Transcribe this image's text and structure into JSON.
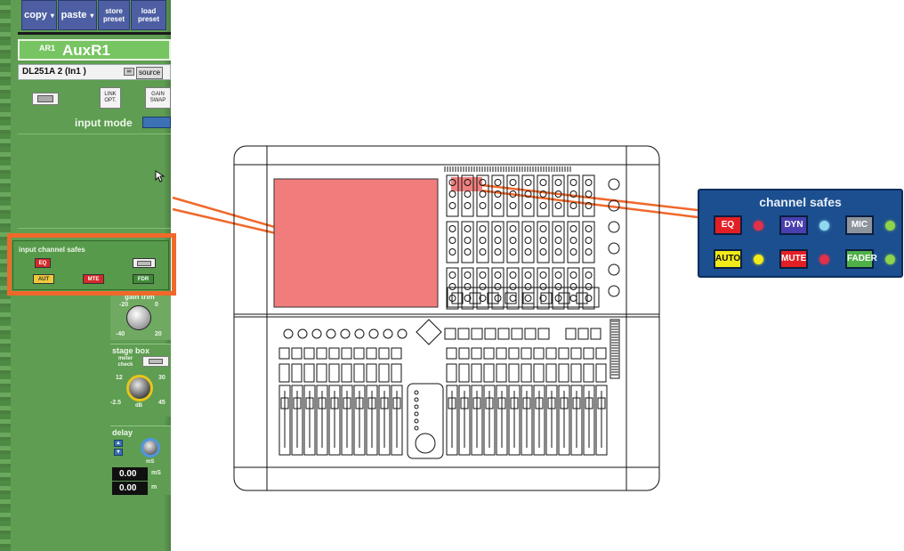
{
  "toolbar": {
    "copy_label": "copy",
    "paste_label": "paste",
    "store_preset_label": "store preset",
    "load_preset_label": "load preset",
    "dropdown_glyph": "▾"
  },
  "channel": {
    "tag": "AR1",
    "name": "AuxR1",
    "input_source": "DL251A 2  (In1 )",
    "source_button": "source",
    "link_opt_label": "LINK OPT.",
    "gain_swap_label": "GAIN SWAP",
    "input_mode_label": "input mode"
  },
  "input_safes": {
    "title": "input channel safes",
    "eq": "EQ",
    "aut": "AUT",
    "mte": "MTE",
    "fdr": "FDR"
  },
  "gain": {
    "label": "gain trim",
    "t1": "-20",
    "t2": "0",
    "t3": "-40",
    "t4": "20"
  },
  "stage_box": {
    "title": "stage box",
    "meter_check": "meter check",
    "t1": "12",
    "t2": "30",
    "t3": "-2.5",
    "t4": "45",
    "unit": "dB"
  },
  "delay": {
    "title": "delay",
    "unit_ms": "mS",
    "value_ms": "0.00",
    "unit_ms2": "mS",
    "value_m": "0.00",
    "unit_m": "m"
  },
  "channel_safes": {
    "title": "channel safes",
    "buttons": [
      {
        "label": "EQ",
        "color": "#e31f26",
        "text": "#ffffff",
        "led": "#e0304a"
      },
      {
        "label": "DYN",
        "color": "#4a3fae",
        "text": "#ffffff",
        "led": "#8fd7ef"
      },
      {
        "label": "MIC",
        "color": "#8d949c",
        "text": "#ffffff",
        "led": "#8fd24c"
      },
      {
        "label": "AUTO",
        "color": "#f2ea1a",
        "text": "#111111",
        "led": "#f2ea1a"
      },
      {
        "label": "MUTE",
        "color": "#e31f26",
        "text": "#ffffff",
        "led": "#e0304a"
      },
      {
        "label": "FADER",
        "color": "#4fb047",
        "text": "#ffffff",
        "led": "#8fd24c"
      }
    ]
  },
  "colors": {
    "accent_orange": "#f0682a",
    "highlight_pink": "#f08080",
    "software_green": "#5e9d52",
    "panel_blue": "#1c4f8f"
  }
}
